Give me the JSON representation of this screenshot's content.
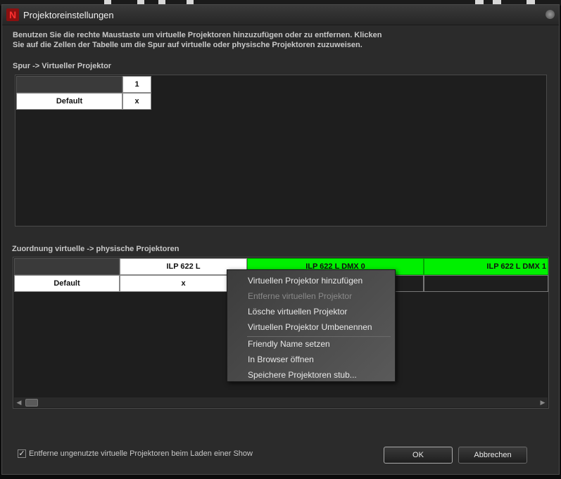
{
  "window": {
    "title": "Projektoreinstellungen"
  },
  "intro": {
    "line1": "Benutzen Sie die rechte Maustaste um virtuelle Projektoren hinzuzufügen oder zu entfernen. Klicken",
    "line2": "Sie auf die Zellen der Tabelle um die Spur auf virtuelle oder physische Projektoren zuzuweisen."
  },
  "track_section": {
    "label": "Spur -> Virtueller Projektor",
    "column_header": "1",
    "row_label": "Default",
    "cell_value": "x"
  },
  "mapping_section": {
    "label": "Zuordnung virtuelle -> physische Projektoren",
    "columns": [
      "ILP 622 L",
      "ILP 622 L DMX 0",
      "ILP 622 L DMX 1"
    ],
    "row_label": "Default",
    "cells": [
      "x",
      "",
      ""
    ]
  },
  "context_menu": {
    "items": [
      {
        "label": "Virtuellen Projektor hinzufügen",
        "enabled": true
      },
      {
        "label": "Entferne virtuellen Projektor",
        "enabled": false
      },
      {
        "label": "Lösche virtuellen Projektor",
        "enabled": true
      },
      {
        "label": "Virtuellen Projektor Umbenennen",
        "enabled": true
      },
      {
        "label": "Friendly Name setzen",
        "enabled": true
      },
      {
        "label": "In Browser öffnen",
        "enabled": true
      },
      {
        "label": "Speichere Projektoren stub...",
        "enabled": true
      }
    ]
  },
  "footer": {
    "checkbox_label": "Entferne ungenutzte virtuelle Projektoren beim Laden einer Show",
    "checkbox_checked": true,
    "ok_label": "OK",
    "cancel_label": "Abbrechen"
  },
  "colors": {
    "physical_projector_active": "#00f000",
    "background": "#2b2b2b"
  }
}
